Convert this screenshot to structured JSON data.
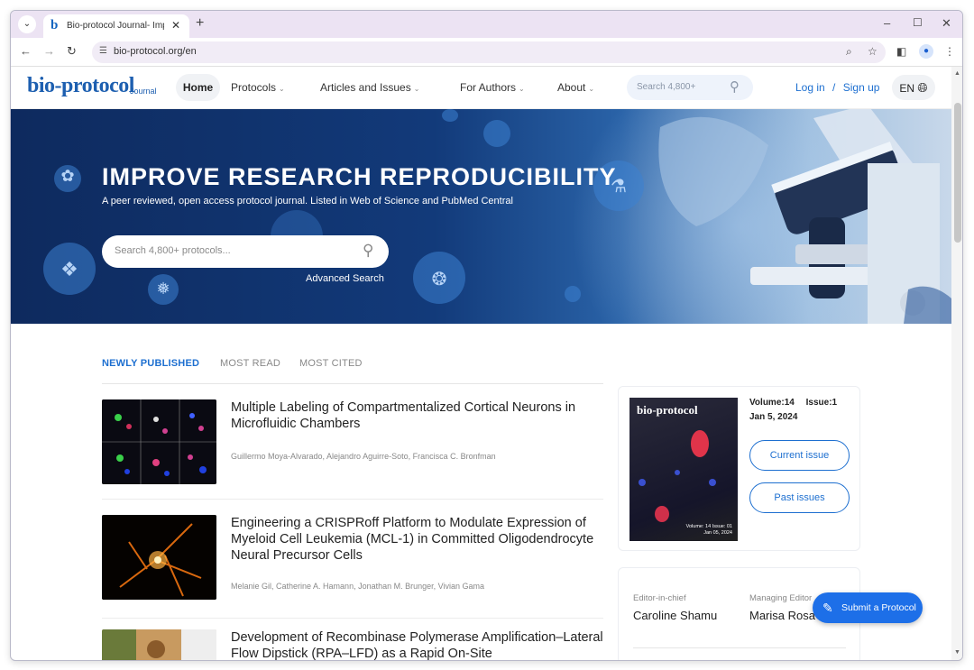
{
  "browser": {
    "tab_title": "Bio-protocol Journal- Improv",
    "tab_favicon": "b",
    "url": "bio-protocol.org/en",
    "icons": [
      "tab-menu-icon",
      "close-icon",
      "new-tab-icon",
      "minimize-icon",
      "maximize-icon",
      "close-window-icon",
      "back-icon",
      "forward-icon",
      "reload-icon",
      "site-info-icon",
      "zoom-icon",
      "bookmark-star-icon",
      "side-panel-icon",
      "profile-icon",
      "more-menu-icon"
    ]
  },
  "header": {
    "logo": "bio-protocol",
    "logo_sub": "Journal",
    "nav": {
      "home": "Home",
      "protocols": "Protocols",
      "articles": "Articles and Issues",
      "authors": "For Authors",
      "about": "About"
    },
    "search_placeholder": "Search 4,800+",
    "login": "Log in",
    "separator": "/",
    "signup": "Sign up",
    "lang": "EN"
  },
  "hero": {
    "title": "IMPROVE RESEARCH REPRODUCIBILITY",
    "subtitle": "A peer reviewed, open access protocol journal. Listed in Web of Science and PubMed Central",
    "search_placeholder": "Search 4,800+ protocols...",
    "advanced_search": "Advanced Search"
  },
  "tabs": {
    "newly_published": "NEWLY PUBLISHED",
    "most_read": "MOST READ",
    "most_cited": "MOST CITED"
  },
  "articles": [
    {
      "title": "Multiple Labeling of Compartmentalized Cortical Neurons in Microfluidic Chambers",
      "authors": "Guillermo Moya-Alvarado, Alejandro Aguirre-Soto, Francisca C. Bronfman"
    },
    {
      "title": "Engineering a CRISPRoff Platform to Modulate Expression of Myeloid Cell Leukemia (MCL-1) in Committed Oligodendrocyte Neural Precursor Cells",
      "authors": "Melanie Gil, Catherine A. Hamann, Jonathan M. Brunger, Vivian Gama"
    },
    {
      "title": "Development of Recombinase Polymerase Amplification–Lateral Flow Dipstick (RPA–LFD) as a Rapid On-Site",
      "authors": ""
    }
  ],
  "issue": {
    "cover_logo": "bio-protocol",
    "volume": "Volume:14",
    "issue": "Issue:1",
    "date": "Jan 5, 2024",
    "cover_vol": "Volume: 14",
    "cover_issue": "Issue: 01",
    "cover_date": "Jan 05, 2024",
    "current_issue": "Current issue",
    "past_issues": "Past issues"
  },
  "editors": {
    "chief_label": "Editor-in-chief",
    "chief_name": "Caroline Shamu",
    "managing_label": "Managing Editor",
    "managing_name": "Marisa Rosa"
  },
  "fab": {
    "label": "Submit a Protocol",
    "icon": "pencil-icon"
  }
}
